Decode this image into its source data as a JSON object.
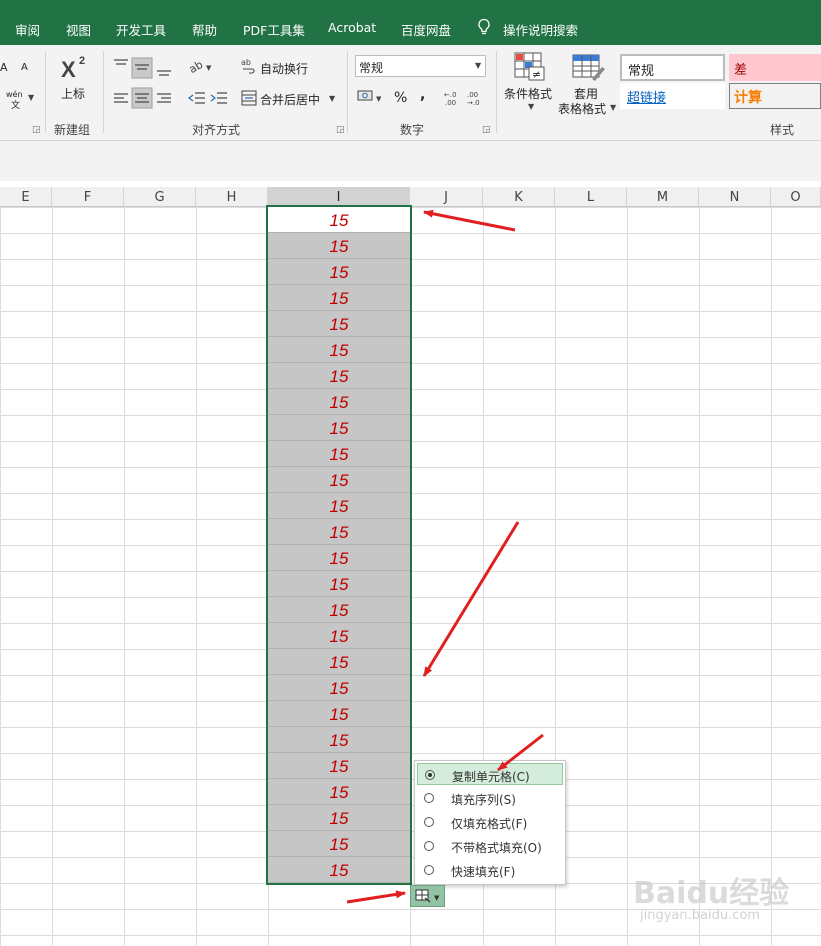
{
  "menu": {
    "tabs": [
      "审阅",
      "视图",
      "开发工具",
      "帮助",
      "PDF工具集",
      "Acrobat",
      "百度网盘"
    ],
    "tell_me": "操作说明搜索",
    "icon": "lightbulb-icon"
  },
  "ribbon": {
    "font_partial": {
      "grow": "A",
      "shrink": "A",
      "wen_top": "wén",
      "wen_bottom": "文"
    },
    "new_group": {
      "superscript_label": "上标",
      "group_label": "新建组"
    },
    "alignment": {
      "wrap_text": "自动换行",
      "merge_center": "合并后居中",
      "group_label": "对齐方式"
    },
    "number": {
      "format_value": "常规",
      "percent": "%",
      "comma": ",",
      "inc_dec": "←.0\n.00",
      "dec_dec": ".00\n→.0",
      "group_label": "数字"
    },
    "styles": {
      "conditional": "条件格式",
      "table_line1": "套用",
      "table_line2": "表格格式",
      "normal": "常规",
      "bad": "差",
      "hyperlink": "超链接",
      "calculation": "计算",
      "group_label": "样式"
    },
    "colors": {
      "bad_bg": "#ffc7ce",
      "bad_text": "#9c0006",
      "calc_text": "#fa7d00",
      "link": "#0563c1"
    }
  },
  "grid": {
    "columns": [
      "E",
      "F",
      "G",
      "H",
      "I",
      "J",
      "K",
      "L",
      "M",
      "N",
      "O"
    ],
    "selected_column": "I",
    "values": [
      "15",
      "15",
      "15",
      "15",
      "15",
      "15",
      "15",
      "15",
      "15",
      "15",
      "15",
      "15",
      "15",
      "15",
      "15",
      "15",
      "15",
      "15",
      "15",
      "15",
      "15",
      "15",
      "15",
      "15",
      "15",
      "15"
    ],
    "value_color": "#c00000"
  },
  "autofill_menu": {
    "options": [
      "复制单元格(C)",
      "填充序列(S)",
      "仅填充格式(F)",
      "不带格式填充(O)",
      "快速填充(F)"
    ],
    "selected_index": 0
  },
  "watermark": {
    "logo": "Baidu经验",
    "url": "jingyan.baidu.com"
  }
}
